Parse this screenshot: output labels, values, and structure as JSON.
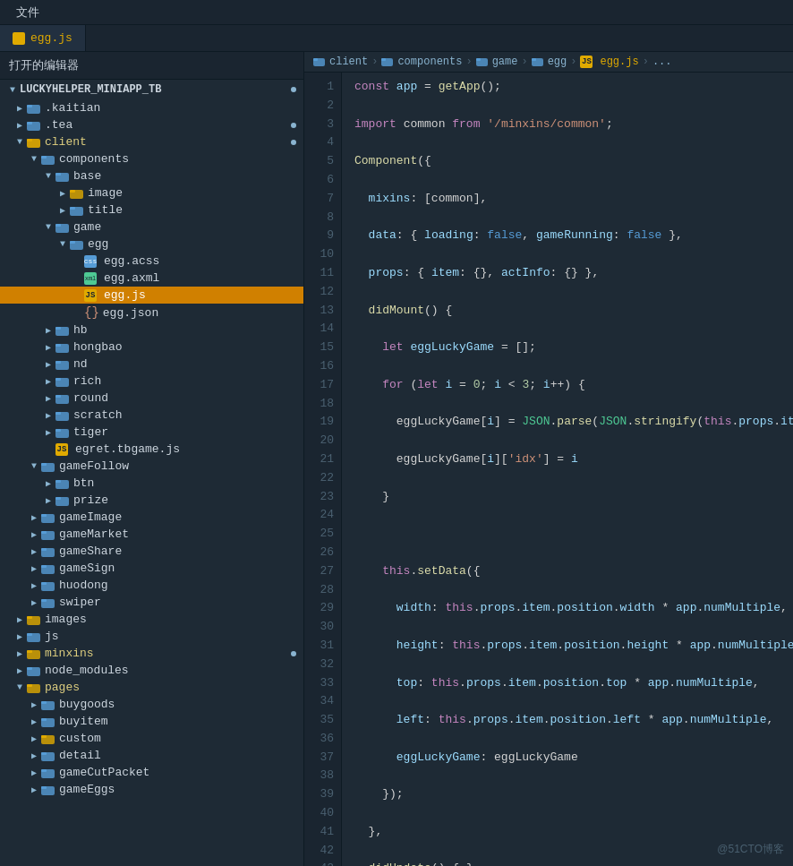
{
  "menubar": {
    "items": [
      "文件"
    ]
  },
  "tab": {
    "filename": "egg.js",
    "icon_color": "#e0aa00"
  },
  "sidebar": {
    "header_label": "打开的编辑器",
    "project_name": "LUCKYHELPER_MINIAPP_TB",
    "dot_color": "#8ab4d0"
  },
  "breadcrumb": {
    "items": [
      "client",
      "components",
      "game",
      "egg",
      "egg.js",
      "..."
    ]
  },
  "watermark": "@51CTO博客"
}
